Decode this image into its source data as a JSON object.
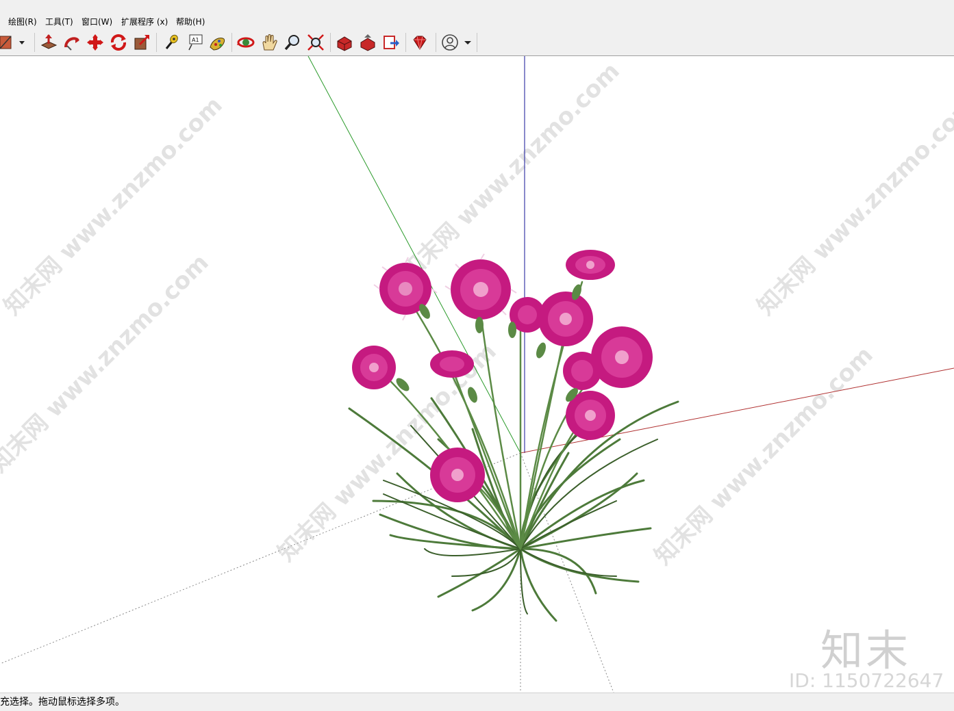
{
  "menubar": {
    "items": [
      {
        "label": "绘图(R)"
      },
      {
        "label": "工具(T)"
      },
      {
        "label": "窗口(W)"
      },
      {
        "label": "扩展程序 (x)"
      },
      {
        "label": "帮助(H)"
      }
    ]
  },
  "toolbar": {
    "tools": [
      {
        "icon": "paint-bucket-icon"
      },
      {
        "icon": "dropdown-arrow-icon"
      },
      {
        "icon": "push-pull-icon"
      },
      {
        "icon": "follow-me-icon"
      },
      {
        "icon": "move-icon"
      },
      {
        "icon": "rotate-icon"
      },
      {
        "icon": "scale-icon"
      },
      {
        "icon": "tape-measure-icon"
      },
      {
        "icon": "text-icon"
      },
      {
        "icon": "paint-icon"
      },
      {
        "icon": "orbit-icon"
      },
      {
        "icon": "pan-icon"
      },
      {
        "icon": "zoom-icon"
      },
      {
        "icon": "zoom-extents-icon"
      },
      {
        "icon": "warehouse-icon"
      },
      {
        "icon": "share-model-icon"
      },
      {
        "icon": "upload-component-icon"
      },
      {
        "icon": "ruby-extension-icon"
      },
      {
        "icon": "account-icon"
      },
      {
        "icon": "account-dropdown-icon"
      }
    ],
    "text_tool_label": "A1"
  },
  "viewport": {
    "watermark_text": "知末网 www.znzmo.com",
    "brand_mark": "知末",
    "id_mark": "ID: 1150722647",
    "axis_colors": {
      "red": "#b03030",
      "green": "#2a9a2a",
      "blue": "#3a3aa8"
    },
    "flower_color": "#d0208a",
    "leaf_color": "#4d7a3a"
  },
  "statusbar": {
    "text": "扩充选择。拖动鼠标选择多项。"
  }
}
